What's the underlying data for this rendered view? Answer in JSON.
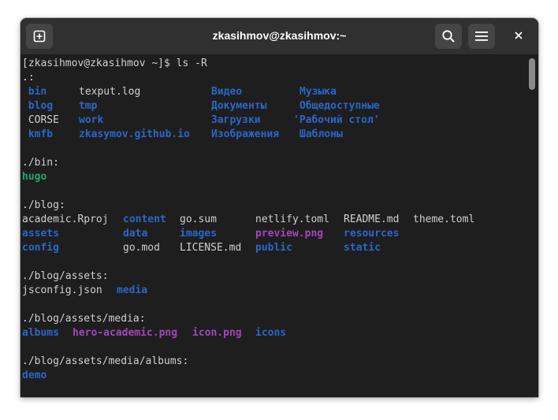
{
  "window": {
    "title": "zkasihmov@zkasihmov:~",
    "icons": [
      "new-tab-icon",
      "search-icon",
      "menu-icon",
      "close-icon"
    ]
  },
  "colors": {
    "directory": "#2a67c9",
    "executable": "#26a269",
    "image": "#a347ba",
    "text": "#d0d0d0",
    "background": "#1e1e1e"
  },
  "terminal": {
    "prompt": "[zkasihmov@zkasihmov ~]$ ls -R",
    "root_header": ".:",
    "root_entries": [
      " bin",
      "texput.log",
      "Видео",
      "Музыка",
      " blog",
      "tmp",
      "Документы",
      "Общедоступные",
      " CORSE",
      "work",
      "Загрузки",
      "'Рабочий стол'",
      " kmfb",
      "zkasymov.github.io",
      "Изображения",
      "Шаблоны"
    ],
    "bin_header": "./bin:",
    "bin_entries": [
      "hugo"
    ],
    "blog_header": "./blog:",
    "blog_entries": [
      "academic.Rproj",
      "content",
      "go.sum",
      "netlify.toml",
      "README.md",
      "theme.toml",
      "assets",
      "data",
      "images",
      "preview.png",
      "resources",
      "config",
      "go.mod",
      "LICENSE.md",
      "public",
      "static"
    ],
    "assets_header": "./blog/assets:",
    "assets_entries": [
      "jsconfig.json",
      "media"
    ],
    "media_header": "./blog/assets/media:",
    "media_entries": [
      "albums",
      "hero-academic.png",
      "icon.png",
      "icons"
    ],
    "albums_header": "./blog/assets/media/albums:",
    "albums_entries": [
      "demo"
    ]
  }
}
